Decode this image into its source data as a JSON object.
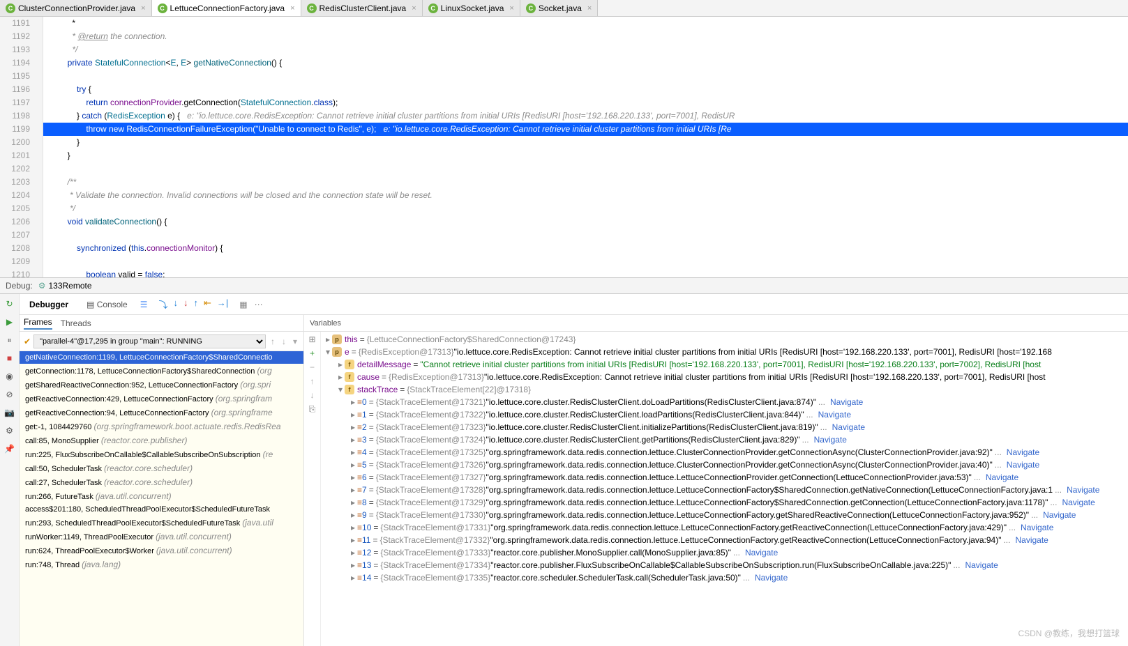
{
  "tabs": [
    {
      "name": "ClusterConnectionProvider.java",
      "active": false
    },
    {
      "name": "LettuceConnectionFactory.java",
      "active": true
    },
    {
      "name": "RedisClusterClient.java",
      "active": false
    },
    {
      "name": "LinuxSocket.java",
      "active": false
    },
    {
      "name": "Socket.java",
      "active": false
    }
  ],
  "lines": {
    "start": 1191,
    "end": 1210,
    "highlight": 1199
  },
  "hints": {
    "1198": "e: \"io.lettuce.core.RedisException: Cannot retrieve initial cluster partitions from initial URIs [RedisURI [host='192.168.220.133', port=7001], RedisUR",
    "1199": "e: \"io.lettuce.core.RedisException: Cannot retrieve initial cluster partitions from initial URIs [Re"
  },
  "code_text": {
    "comment_return": " * @return the connection.",
    "comment_end": " */",
    "try": "try {",
    "throw_str": "\"Unable to connect to Redis\"",
    "comment_validate": " * Validate the connection. Invalid connections will be closed and the connection state will be reset.",
    "comment_start": "/**"
  },
  "debug": {
    "label": "Debug:",
    "config": "133Remote",
    "debugger_tab": "Debugger",
    "console_tab": "Console",
    "frames_tab": "Frames",
    "threads_tab": "Threads",
    "variables_tab": "Variables",
    "thread": "\"parallel-4\"@17,295 in group \"main\": RUNNING"
  },
  "frames": [
    {
      "m": "getNativeConnection:1199, LettuceConnectionFactory$SharedConnectio",
      "sel": true,
      "lib": false
    },
    {
      "m": "getConnection:1178, LettuceConnectionFactory$SharedConnection",
      "loc": "(org",
      "lib": true
    },
    {
      "m": "getSharedReactiveConnection:952, LettuceConnectionFactory",
      "loc": "(org.spri",
      "lib": true
    },
    {
      "m": "getReactiveConnection:429, LettuceConnectionFactory",
      "loc": "(org.springfram",
      "lib": true
    },
    {
      "m": "getReactiveConnection:94, LettuceConnectionFactory",
      "loc": "(org.springframe",
      "lib": true
    },
    {
      "m": "get:-1, 1084429760",
      "loc": "(org.springframework.boot.actuate.redis.RedisRea",
      "lib": true
    },
    {
      "m": "call:85, MonoSupplier",
      "loc": "(reactor.core.publisher)",
      "lib": true
    },
    {
      "m": "run:225, FluxSubscribeOnCallable$CallableSubscribeOnSubscription",
      "loc": "(re",
      "lib": true
    },
    {
      "m": "call:50, SchedulerTask",
      "loc": "(reactor.core.scheduler)",
      "lib": true
    },
    {
      "m": "call:27, SchedulerTask",
      "loc": "(reactor.core.scheduler)",
      "lib": true
    },
    {
      "m": "run:266, FutureTask",
      "loc": "(java.util.concurrent)",
      "lib": false
    },
    {
      "m": "access$201:180, ScheduledThreadPoolExecutor$ScheduledFutureTask",
      "lib": false
    },
    {
      "m": "run:293, ScheduledThreadPoolExecutor$ScheduledFutureTask",
      "loc": "(java.util",
      "lib": false
    },
    {
      "m": "runWorker:1149, ThreadPoolExecutor",
      "loc": "(java.util.concurrent)",
      "lib": false
    },
    {
      "m": "run:624, ThreadPoolExecutor$Worker",
      "loc": "(java.util.concurrent)",
      "lib": false
    },
    {
      "m": "run:748, Thread",
      "loc": "(java.lang)",
      "lib": false
    }
  ],
  "vars": {
    "this": {
      "name": "this",
      "type": "{LettuceConnectionFactory$SharedConnection@17243}"
    },
    "e": {
      "name": "e",
      "type": "{RedisException@17313}",
      "val": "\"io.lettuce.core.RedisException: Cannot retrieve initial cluster partitions from initial URIs [RedisURI [host='192.168.220.133', port=7001], RedisURI [host='192.168"
    },
    "detailMessage": {
      "name": "detailMessage",
      "val": "\"Cannot retrieve initial cluster partitions from initial URIs [RedisURI [host='192.168.220.133', port=7001], RedisURI [host='192.168.220.133', port=7002], RedisURI [host"
    },
    "cause": {
      "name": "cause",
      "type": "{RedisException@17313}",
      "val": "\"io.lettuce.core.RedisException: Cannot retrieve initial cluster partitions from initial URIs [RedisURI [host='192.168.220.133', port=7001], RedisURI [host"
    },
    "stackTrace": {
      "name": "stackTrace",
      "type": "{StackTraceElement[22]@17318}"
    },
    "items": [
      {
        "i": "0",
        "t": "{StackTraceElement@17321}",
        "v": "\"io.lettuce.core.cluster.RedisClusterClient.doLoadPartitions(RedisClusterClient.java:874)\""
      },
      {
        "i": "1",
        "t": "{StackTraceElement@17322}",
        "v": "\"io.lettuce.core.cluster.RedisClusterClient.loadPartitions(RedisClusterClient.java:844)\""
      },
      {
        "i": "2",
        "t": "{StackTraceElement@17323}",
        "v": "\"io.lettuce.core.cluster.RedisClusterClient.initializePartitions(RedisClusterClient.java:819)\""
      },
      {
        "i": "3",
        "t": "{StackTraceElement@17324}",
        "v": "\"io.lettuce.core.cluster.RedisClusterClient.getPartitions(RedisClusterClient.java:829)\""
      },
      {
        "i": "4",
        "t": "{StackTraceElement@17325}",
        "v": "\"org.springframework.data.redis.connection.lettuce.ClusterConnectionProvider.getConnectionAsync(ClusterConnectionProvider.java:92)\""
      },
      {
        "i": "5",
        "t": "{StackTraceElement@17326}",
        "v": "\"org.springframework.data.redis.connection.lettuce.ClusterConnectionProvider.getConnectionAsync(ClusterConnectionProvider.java:40)\""
      },
      {
        "i": "6",
        "t": "{StackTraceElement@17327}",
        "v": "\"org.springframework.data.redis.connection.lettuce.LettuceConnectionProvider.getConnection(LettuceConnectionProvider.java:53)\""
      },
      {
        "i": "7",
        "t": "{StackTraceElement@17328}",
        "v": "\"org.springframework.data.redis.connection.lettuce.LettuceConnectionFactory$SharedConnection.getNativeConnection(LettuceConnectionFactory.java:1"
      },
      {
        "i": "8",
        "t": "{StackTraceElement@17329}",
        "v": "\"org.springframework.data.redis.connection.lettuce.LettuceConnectionFactory$SharedConnection.getConnection(LettuceConnectionFactory.java:1178)\""
      },
      {
        "i": "9",
        "t": "{StackTraceElement@17330}",
        "v": "\"org.springframework.data.redis.connection.lettuce.LettuceConnectionFactory.getSharedReactiveConnection(LettuceConnectionFactory.java:952)\""
      },
      {
        "i": "10",
        "t": "{StackTraceElement@17331}",
        "v": "\"org.springframework.data.redis.connection.lettuce.LettuceConnectionFactory.getReactiveConnection(LettuceConnectionFactory.java:429)\""
      },
      {
        "i": "11",
        "t": "{StackTraceElement@17332}",
        "v": "\"org.springframework.data.redis.connection.lettuce.LettuceConnectionFactory.getReactiveConnection(LettuceConnectionFactory.java:94)\""
      },
      {
        "i": "12",
        "t": "{StackTraceElement@17333}",
        "v": "\"reactor.core.publisher.MonoSupplier.call(MonoSupplier.java:85)\""
      },
      {
        "i": "13",
        "t": "{StackTraceElement@17334}",
        "v": "\"reactor.core.publisher.FluxSubscribeOnCallable$CallableSubscribeOnSubscription.run(FluxSubscribeOnCallable.java:225)\""
      },
      {
        "i": "14",
        "t": "{StackTraceElement@17335}",
        "v": "\"reactor.core.scheduler.SchedulerTask.call(SchedulerTask.java:50)\""
      }
    ]
  },
  "nav": "Navigate",
  "watermark": "CSDN @教练，我想打篮球"
}
